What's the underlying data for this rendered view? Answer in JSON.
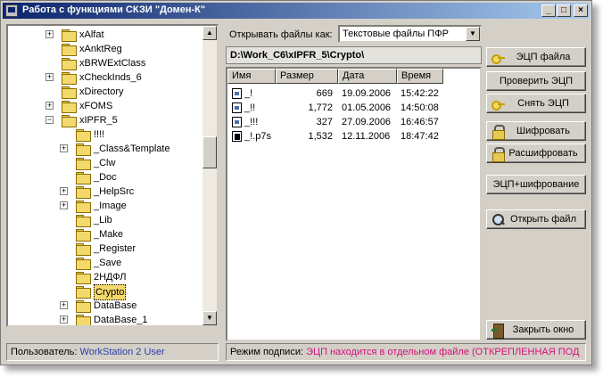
{
  "window": {
    "title": "Работа с функциями СКЗИ \"Домен-К\"",
    "min_label": "_",
    "max_label": "□",
    "close_label": "×"
  },
  "tree": {
    "items": [
      {
        "label": "xAlfat",
        "expander": "+",
        "level": 0
      },
      {
        "label": "xAnktReg",
        "expander": "",
        "level": 0
      },
      {
        "label": "xBRWExtClass",
        "expander": "",
        "level": 0
      },
      {
        "label": "xCheckInds_6",
        "expander": "+",
        "level": 0
      },
      {
        "label": "xDirectory",
        "expander": "",
        "level": 0
      },
      {
        "label": "xFOMS",
        "expander": "+",
        "level": 0
      },
      {
        "label": "xIPFR_5",
        "expander": "−",
        "level": 0
      },
      {
        "label": "!!!!",
        "expander": "",
        "level": 1
      },
      {
        "label": "_Class&Template",
        "expander": "+",
        "level": 1
      },
      {
        "label": "_Clw",
        "expander": "",
        "level": 1
      },
      {
        "label": "_Doc",
        "expander": "",
        "level": 1
      },
      {
        "label": "_HelpSrc",
        "expander": "+",
        "level": 1
      },
      {
        "label": "_Image",
        "expander": "+",
        "level": 1
      },
      {
        "label": "_Lib",
        "expander": "",
        "level": 1
      },
      {
        "label": "_Make",
        "expander": "",
        "level": 1
      },
      {
        "label": "_Register",
        "expander": "",
        "level": 1
      },
      {
        "label": "_Save",
        "expander": "",
        "level": 1
      },
      {
        "label": "2НДФЛ",
        "expander": "",
        "level": 1
      },
      {
        "label": "Crypto",
        "expander": "",
        "level": 1,
        "selected": true
      },
      {
        "label": "DataBase",
        "expander": "+",
        "level": 1
      },
      {
        "label": "DataBase_1",
        "expander": "+",
        "level": 1
      }
    ]
  },
  "open_as": {
    "label": "Открывать файлы как:",
    "value": "Текстовые файлы ПФР"
  },
  "path": "D:\\Work_C6\\xIPFR_5\\Crypto\\",
  "files": {
    "columns": [
      "Имя",
      "Размер",
      "Дата",
      "Время"
    ],
    "rows": [
      {
        "name": "_!",
        "size": "669",
        "date": "19.09.2006",
        "time": "15:42:22",
        "icon": "file"
      },
      {
        "name": "_!!",
        "size": "1,772",
        "date": "01.05.2006",
        "time": "14:50:08",
        "icon": "file"
      },
      {
        "name": "_!!!",
        "size": "327",
        "date": "27.09.2006",
        "time": "16:46:57",
        "icon": "file"
      },
      {
        "name": "_!.p7s",
        "size": "1,532",
        "date": "12.11.2006",
        "time": "18:47:42",
        "icon": "signed-file"
      }
    ]
  },
  "buttons": {
    "sign_file": "ЭЦП файла",
    "verify_sign": "Проверить ЭЦП",
    "remove_sign": "Снять ЭЦП",
    "encrypt": "Шифровать",
    "decrypt": "Расшифровать",
    "sign_encrypt": "ЭЦП+шифрование",
    "open_file": "Открыть файл",
    "close_window": "Закрыть окно"
  },
  "status": {
    "user_label": "Пользователь:",
    "user_value": "WorkStation 2 User",
    "mode_label": "Режим подписи:",
    "mode_value": "ЭЦП находится в отдельном файле (ОТКРЕПЛЕННАЯ ПОД"
  }
}
